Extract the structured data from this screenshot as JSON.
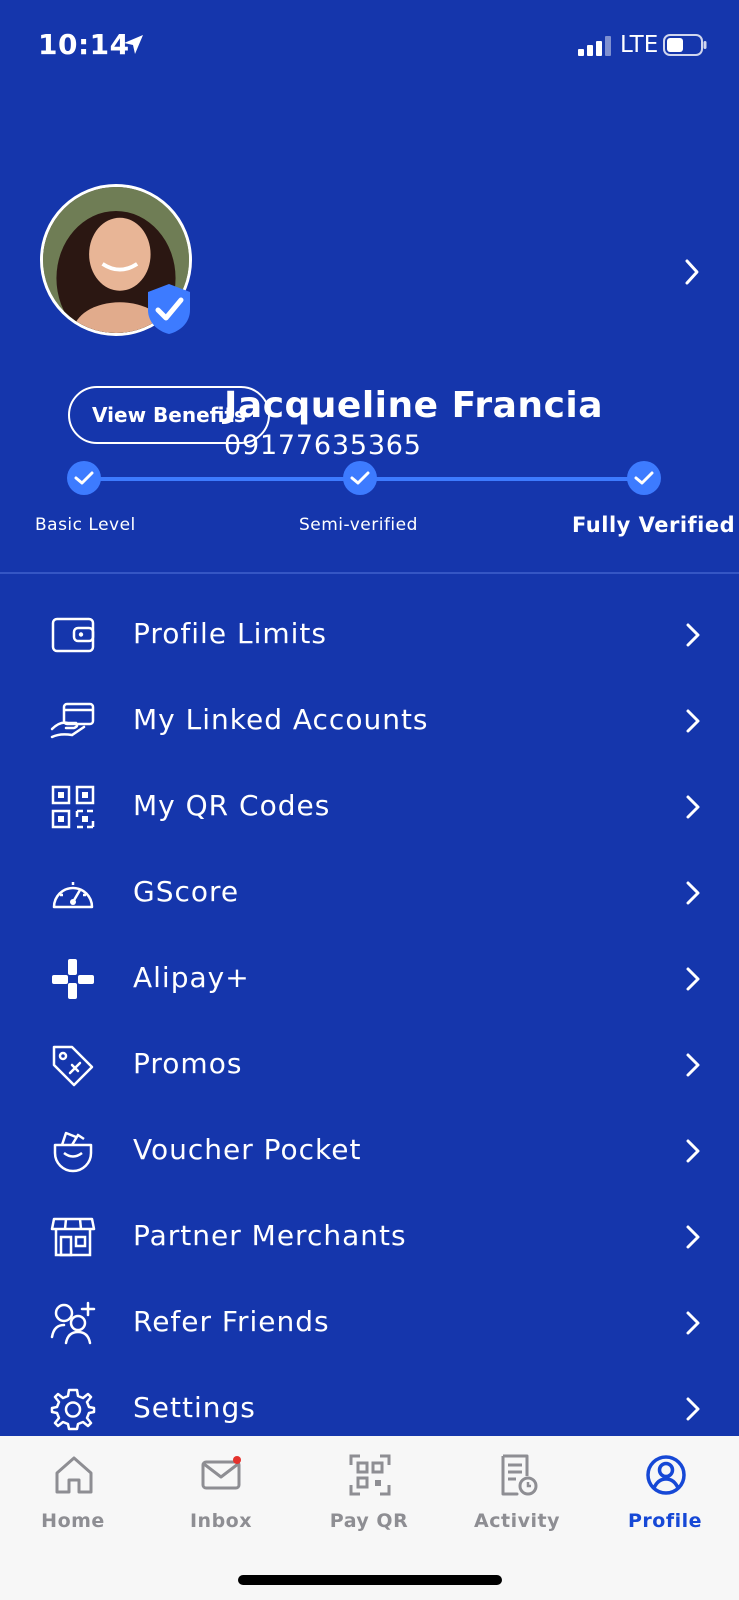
{
  "status_bar": {
    "time": "10:14",
    "network": "LTE"
  },
  "profile": {
    "name": "Jacqueline Francia",
    "phone": "09177635365"
  },
  "benefits_button": "View Benefits",
  "verification_steps": [
    "Basic Level",
    "Semi-verified",
    "Fully Verified"
  ],
  "menu": [
    {
      "label": "Profile Limits",
      "icon": "wallet-icon"
    },
    {
      "label": "My Linked Accounts",
      "icon": "card-hand-icon"
    },
    {
      "label": "My QR Codes",
      "icon": "qr-code-icon"
    },
    {
      "label": "GScore",
      "icon": "gauge-icon"
    },
    {
      "label": "Alipay+",
      "icon": "plus-icon"
    },
    {
      "label": "Promos",
      "icon": "tag-icon"
    },
    {
      "label": "Voucher Pocket",
      "icon": "pocket-icon"
    },
    {
      "label": "Partner Merchants",
      "icon": "store-icon"
    },
    {
      "label": "Refer Friends",
      "icon": "add-user-icon"
    },
    {
      "label": "Settings",
      "icon": "gear-icon"
    }
  ],
  "tabs": [
    {
      "label": "Home",
      "icon": "home-icon"
    },
    {
      "label": "Inbox",
      "icon": "mail-icon"
    },
    {
      "label": "Pay QR",
      "icon": "qr-scan-icon"
    },
    {
      "label": "Activity",
      "icon": "activity-icon"
    },
    {
      "label": "Profile",
      "icon": "profile-icon"
    }
  ],
  "colors": {
    "background": "#1536AC",
    "accent": "#3D7BFF",
    "tab_active": "#1648D6",
    "tab_inactive": "#8E8E93"
  }
}
